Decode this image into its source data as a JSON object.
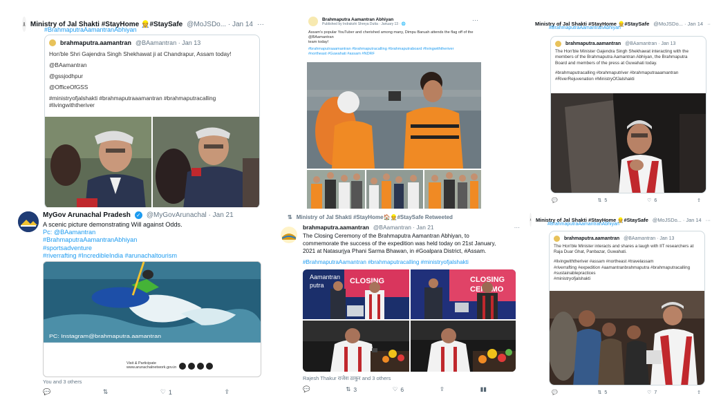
{
  "cards": {
    "c1": {
      "author": "Ministry of Jal Shakti #StayHome",
      "emoji": "👷",
      "author_tail": "#StaySafe",
      "handle_date": "@MoJSDo... · Jan 14",
      "hashtag": "#BrahmaputraAamantranAbhiyan",
      "quote_author": "brahmaputra.aamantran",
      "quote_handle_date": "@BAamantran · Jan 13",
      "quote_lines": [
        "Hon'ble Shri Gajendra Singh Shekhawat ji at Chandrapur, Assam today!",
        "",
        "@BAamantran",
        "",
        "@gssjodhpur",
        "",
        "@OfficeOfGSS",
        "",
        "#ministryofjalshakti #brahmaputraaamantran #brahmaputracalling",
        "#livingwiththeriver"
      ]
    },
    "c2": {
      "page_name": "Brahmaputra Aamantran Abhiyan",
      "published": "Published by Indrakshi Shreya Dutta · January 13 · 🌐",
      "text_lines": [
        "Assam's popular YouTuber and cherished among many, Dimpu Baruah attends the flag off of the",
        "@BAamantran",
        "team today!"
      ],
      "tag_lines": [
        "#brahmaputraaamantran #brahmaputracalling #brahmaputraboard #livingwiththeriver",
        "#northeast #Guwahati #assam #NDRF"
      ]
    },
    "c3": {
      "author": "Ministry of Jal Shakti #StayHome",
      "emoji": "👷",
      "author_tail": "#StaySafe",
      "handle_date": "@MoJSDo... · Jan 14",
      "hashtag": "#BrahmaputraAamantranAbhiyan",
      "quote_author": "brahmaputra.aamantran",
      "quote_handle_date": "@BAamantran · Jan 13",
      "quote_lines": [
        "The Hon'ble Minister Gajendra Singh Shekhawat interacting with the",
        "members of the Brahmaputra Aamantran Abhiyan, the Brahmaputra",
        "Board and members of the press at Guwahati today.",
        "",
        "#brahmaputracalling #brahmaputriver #brahmaputraaamantran",
        "#RiverRejuvenation #MinistryOfJalshakti"
      ],
      "retweets": "5",
      "likes": "6"
    },
    "c4": {
      "author": "MyGov Arunachal Pradesh",
      "handle_date": "@MyGovArunachal · Jan 21",
      "lines": [
        "A scenic picture demonstrating Will against Odds.",
        "Pc: @BAamantran",
        "#BrahmaputraAamantranAbhiyan",
        "#sportsadventure",
        "#riverrafting #IncredibleIndia #arunachaltourism"
      ],
      "photo_credit": "PC: Instagram@brahmaputra.aamantran",
      "visit_text": "Visit & Participate",
      "social_url": "www.arunachalnetwork.gov.in",
      "liked_by": "You and 3 others",
      "likes": "1"
    },
    "c5": {
      "retweet_header": "Ministry of Jal Shakti #StayHome",
      "retweet_emoji": "🏠",
      "retweet_tail": "👷#StaySafe Retweeted",
      "author": "brahmaputra.aamantran",
      "handle_date": "@BAamantran · Jan 21",
      "lines": [
        "The Closing Ceremony of the Brahmaputra Aamantran Abhiyan, to",
        "commemorate the success of the expedition was held today on 21st January,",
        "2021 at Natasurjya Phani Sarma Bhawan, in #Goalpara District, #Assam."
      ],
      "tags": "#BrahmaputraAamantran #brahmaputracalling #ministryofjalshakti",
      "banner_text": "CLOSING CEREMONY",
      "banner_date": "21-JAN-2021",
      "liked_by": "Rajesh Thakur राजेश ठाकुर and 3 others",
      "retweets": "3",
      "likes": "6"
    },
    "c6": {
      "author": "Ministry of Jal Shakti #StayHome",
      "emoji": "👷",
      "author_tail": "#StaySafe",
      "handle_date": "@MoJSDo... · Jan 14",
      "hashtag": "#BrahmaputraAamantranAbhiyan",
      "quote_author": "brahmaputra.aamantran",
      "quote_handle_date": "@BAamantran · Jan 13",
      "quote_lines": [
        "The Hon'ble Minister interacts and shares a laugh with IIT researchers at",
        "Raja Duar Ghat, Panbazar, Guwahati.",
        "",
        "#livingwiththeriver #assam #northeast #travelassam",
        "#riverrafting #expedition #aamantranbrahmaputra #brahmaputracalling",
        "#sustainablepractices",
        "#ministryofjalshakti"
      ],
      "retweets": "5",
      "likes": "7"
    }
  },
  "colors": {
    "link": "#1d9bf0",
    "muted": "#657786",
    "orange": "#f08a24"
  },
  "icons": [
    "reply-icon",
    "retweet-icon",
    "like-icon",
    "share-icon",
    "analytics-icon",
    "more-icon",
    "verified-icon",
    "emblem-icon"
  ]
}
